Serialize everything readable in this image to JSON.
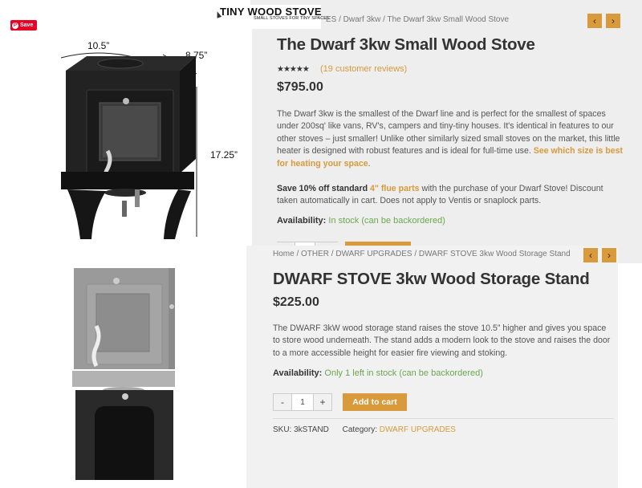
{
  "top": {
    "pin_save": "Save",
    "logo": {
      "title": "TINY WOOD STOVE",
      "tagline": "SMALL STOVES FOR TINY SPACES"
    },
    "dimensions": {
      "width": "10.5”",
      "depth": "8.75”",
      "height": "17.25”"
    },
    "breadcrumb": "ES / Dwarf 3kw / The Dwarf 3kw Small Wood Stove",
    "nav": {
      "prev": "‹",
      "next": "›"
    },
    "title": "The Dwarf 3kw Small Wood Stove",
    "rating_stars": "★★★★★",
    "reviews": "(19 customer reviews)",
    "price": "$795.00",
    "description": {
      "text": "The Dwarf 3kw is the smallest of the Dwarf line and is perfect for the smallest of spaces under 200sq' like vans, RV's, campers and tiny-tiny houses. It's identical in features to our other stoves – just smaller! Unlike other similarly sized small stoves on the market, this little heater is designed with robust features and is ideal for full-time use. ",
      "link": "See which size is best for heating your space",
      "end": "."
    },
    "promo": {
      "bold": "Save 10% off standard",
      "link": "4\" flue parts",
      "text": " with the purchase of your Dwarf Stove! Discount taken automatically in cart. Does not apply to Ventis or snaplock parts."
    },
    "availability_label": "Availability:",
    "availability_value": "In stock (can be backordered)"
  },
  "bottom": {
    "breadcrumb": "Home / OTHER / DWARF UPGRADES / DWARF STOVE 3kw Wood Storage Stand",
    "nav": {
      "prev": "‹",
      "next": "›"
    },
    "title": "DWARF STOVE 3kw Wood Storage Stand",
    "price": "$225.00",
    "description": "The DWARF 3kW wood storage stand raises the stove 10.5” higher and gives you space to store wood underneath.  The stand adds a modern look to the stove and raises the door to a more accessible height for easier fire viewing and stoking.",
    "availability_label": "Availability:",
    "availability_value": "Only 1 left in stock (can be backordered)",
    "quantity": {
      "minus": "-",
      "value": "1",
      "plus": "+"
    },
    "add_to_cart": "Add to cart",
    "sku_label": "SKU:",
    "sku": "3kSTAND",
    "category_label": "Category:",
    "category": "DWARF UPGRADES"
  },
  "colors": {
    "accent": "#d89a3a",
    "in_stock": "#6aa84f",
    "pinterest": "#e60023"
  }
}
